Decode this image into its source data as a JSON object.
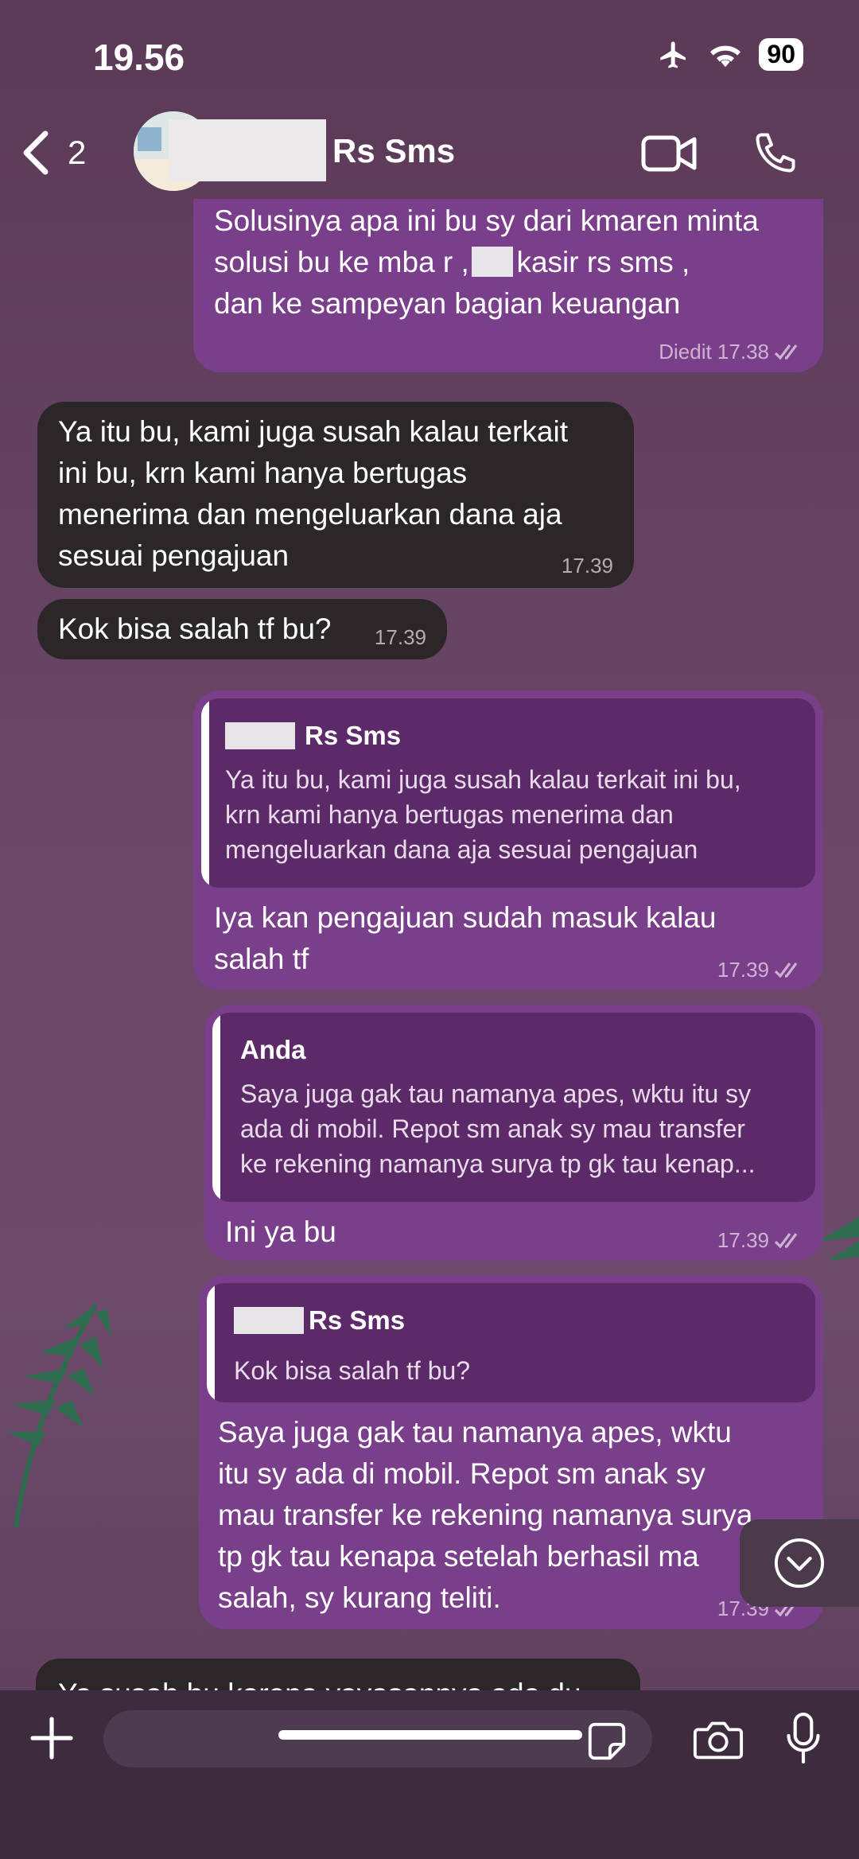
{
  "status_bar": {
    "time": "19.56",
    "battery": "90"
  },
  "header": {
    "back_count": "2",
    "contact_name": "Rs Sms"
  },
  "messages": [
    {
      "text": "Solusinya apa ini bu sy dari kmaren minta\nsolusi bu ke mba r     , ke kasir rs sms ,\ndan ke sampeyan bagian keuangan",
      "meta": "Diedit 17.38"
    },
    {
      "text": "Ya itu bu, kami juga susah kalau terkait\nini bu, krn kami hanya bertugas\nmenerima dan mengeluarkan dana aja\nsesuai pengajuan",
      "meta": "17.39"
    },
    {
      "text": "Kok bisa salah tf bu?",
      "meta": "17.39"
    },
    {
      "quote_name": "Rs Sms",
      "quote_text": "Ya itu bu, kami juga susah kalau terkait ini bu,\nkrn kami hanya bertugas menerima dan\nmengeluarkan dana aja sesuai pengajuan",
      "text": "Iya kan pengajuan sudah masuk kalau\nsalah tf",
      "meta": "17.39"
    },
    {
      "quote_name": "Anda",
      "quote_text": "Saya juga gak tau namanya apes, wktu itu sy\nada di mobil. Repot sm anak sy mau transfer\nke rekening namanya surya tp gk tau kenap...",
      "text": "Ini ya bu",
      "meta": "17.39"
    },
    {
      "quote_name": "Rs Sms",
      "quote_text": "Kok bisa salah tf bu?",
      "text": "Saya juga gak tau namanya apes, wktu\nitu sy ada di mobil. Repot sm anak sy\nmau transfer ke rekening namanya surya\ntp gk tau kenapa setelah berhasil ma\nsalah, sy kurang teliti.",
      "meta": "17.39"
    },
    {
      "text": "Ya susah bu karena yayasannya ada du"
    }
  ],
  "colors": {
    "outgoing": "#7a3f8a",
    "incoming": "#2b2728",
    "quote": "#5c2a68"
  },
  "icons": [
    "back-chevron-icon",
    "video-call-icon",
    "phone-icon",
    "airplane-icon",
    "wifi-icon",
    "plus-icon",
    "sticker-icon",
    "camera-icon",
    "microphone-icon",
    "scroll-down-icon"
  ]
}
